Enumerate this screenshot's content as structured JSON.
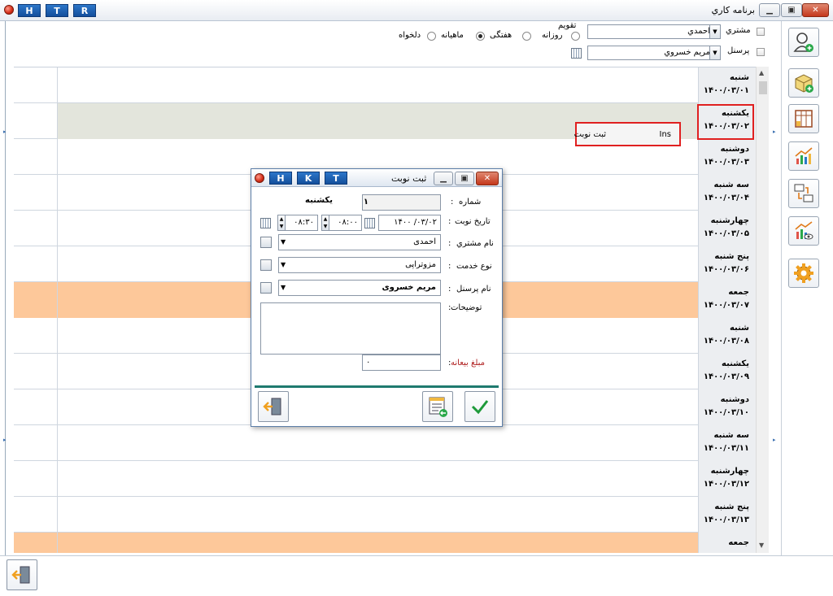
{
  "window": {
    "title": "برنامه کاري",
    "quick_buttons": [
      "H",
      "T",
      "R"
    ]
  },
  "filters": {
    "customer_label": "مشتري",
    "customer_value": "احمدي",
    "personnel_label": "پرسنل",
    "personnel_value": "مريم خسروي",
    "calendar_group_label": "تقويم",
    "view_options": [
      {
        "label": "روزانه",
        "selected": false
      },
      {
        "label": "هفتگی",
        "selected": true
      },
      {
        "label": "ماهيانه",
        "selected": false
      },
      {
        "label": "دلخواه",
        "selected": false
      }
    ]
  },
  "schedule": {
    "rows": [
      {
        "day": "شنبه",
        "date": "۱۴۰۰/۰۳/۰۱",
        "style": "normal"
      },
      {
        "day": "يكشنبه",
        "date": "۱۴۰۰/۰۳/۰۲",
        "style": "gray"
      },
      {
        "day": "دوشنبه",
        "date": "۱۴۰۰/۰۳/۰۳",
        "style": "normal"
      },
      {
        "day": "سه شنبه",
        "date": "۱۴۰۰/۰۳/۰۴",
        "style": "normal"
      },
      {
        "day": "چهارشنبه",
        "date": "۱۴۰۰/۰۳/۰۵",
        "style": "normal"
      },
      {
        "day": "پنج شنبه",
        "date": "۱۴۰۰/۰۳/۰۶",
        "style": "normal"
      },
      {
        "day": "جمعه",
        "date": "۱۴۰۰/۰۳/۰۷",
        "style": "orange"
      },
      {
        "day": "شنبه",
        "date": "۱۴۰۰/۰۳/۰۸",
        "style": "normal"
      },
      {
        "day": "يكشنبه",
        "date": "۱۴۰۰/۰۳/۰۹",
        "style": "normal"
      },
      {
        "day": "دوشنبه",
        "date": "۱۴۰۰/۰۳/۱۰",
        "style": "normal"
      },
      {
        "day": "سه شنبه",
        "date": "۱۴۰۰/۰۳/۱۱",
        "style": "normal"
      },
      {
        "day": "چهارشنبه",
        "date": "۱۴۰۰/۰۳/۱۲",
        "style": "normal"
      },
      {
        "day": "پنج شنبه",
        "date": "۱۴۰۰/۰۳/۱۳",
        "style": "normal"
      },
      {
        "day": "جمعه",
        "date": "",
        "style": "orange"
      }
    ]
  },
  "context_menu": {
    "item_label": "ثبت نوبت",
    "shortcut": "Ins"
  },
  "dialog": {
    "title": "ثبت نوبت",
    "quick_buttons": [
      "H",
      "K",
      "T"
    ],
    "number_label": "شماره",
    "number_value": "۱",
    "weekday_value": "يكشنبه",
    "date_label": "تاريخ نوبت",
    "date_value": "۱۴۰۰ /۰۳/۰۲",
    "time_from": "۰۸:۰۰",
    "time_to": "۰۸:۳۰",
    "customer_label": "نام مشتري",
    "customer_value": "احمدی",
    "service_label": "نوع خدمت",
    "service_value": "مزوتراپی",
    "personnel_label": "نام پرسنل",
    "personnel_value": "مريم خسروی",
    "notes_label": "توضيحات",
    "deposit_label": "مبلغ بيعانه",
    "deposit_value": "۰",
    "colon": ":"
  },
  "colors": {
    "accent_blue": "#1f5fae",
    "highlight_red": "#e02020",
    "friday_orange": "#fdc89a",
    "selected_gray": "#e3e5dc",
    "separator_teal": "#1f7a6f"
  }
}
